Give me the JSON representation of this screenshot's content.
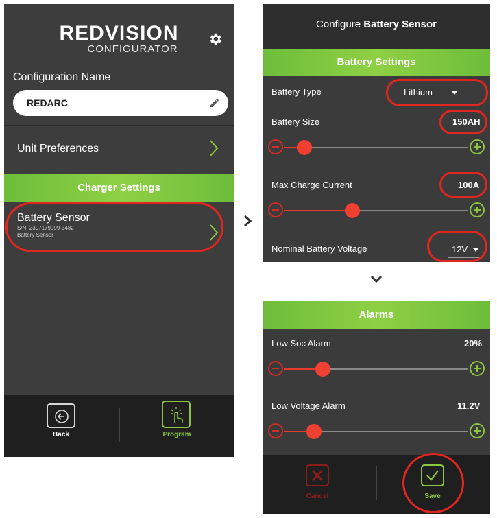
{
  "left": {
    "logo_main": "REDVISION",
    "logo_sub": "CONFIGURATOR",
    "settings_icon": "gear-icon",
    "config_label": "Configuration Name",
    "config_value": "REDARC",
    "edit_icon": "pencil-icon",
    "unit_prefs_label": "Unit Preferences",
    "charger_settings_label": "Charger Settings",
    "sensor": {
      "title": "Battery Sensor",
      "serial": "S/N: 2307179999-3482",
      "type": "Battery Sensor"
    },
    "back_label": "Back",
    "program_label": "Program"
  },
  "battery_screen": {
    "header_prefix": "Configure ",
    "header_bold": "Battery Sensor",
    "section_label": "Battery Settings",
    "battery_type_label": "Battery Type",
    "battery_type_value": "Lithium",
    "battery_size_label": "Battery Size",
    "battery_size_value": "150AH",
    "battery_size_level": 0.11,
    "max_charge_label": "Max Charge Current",
    "max_charge_value": "100A",
    "max_charge_level": 0.37,
    "nominal_voltage_label": "Nominal Battery Voltage",
    "nominal_voltage_value": "12V"
  },
  "alarm_screen": {
    "section_label": "Alarms",
    "low_soc_label": "Low Soc Alarm",
    "low_soc_value": "20%",
    "low_soc_level": 0.21,
    "low_voltage_label": "Low Voltage Alarm",
    "low_voltage_value": "11.2V",
    "low_voltage_level": 0.16,
    "cancel_label": "Cancel",
    "save_label": "Save"
  },
  "colors": {
    "accent_green": "#8cc63f",
    "highlight_red": "#e0261e",
    "screen_bg": "#3b3b3b"
  }
}
